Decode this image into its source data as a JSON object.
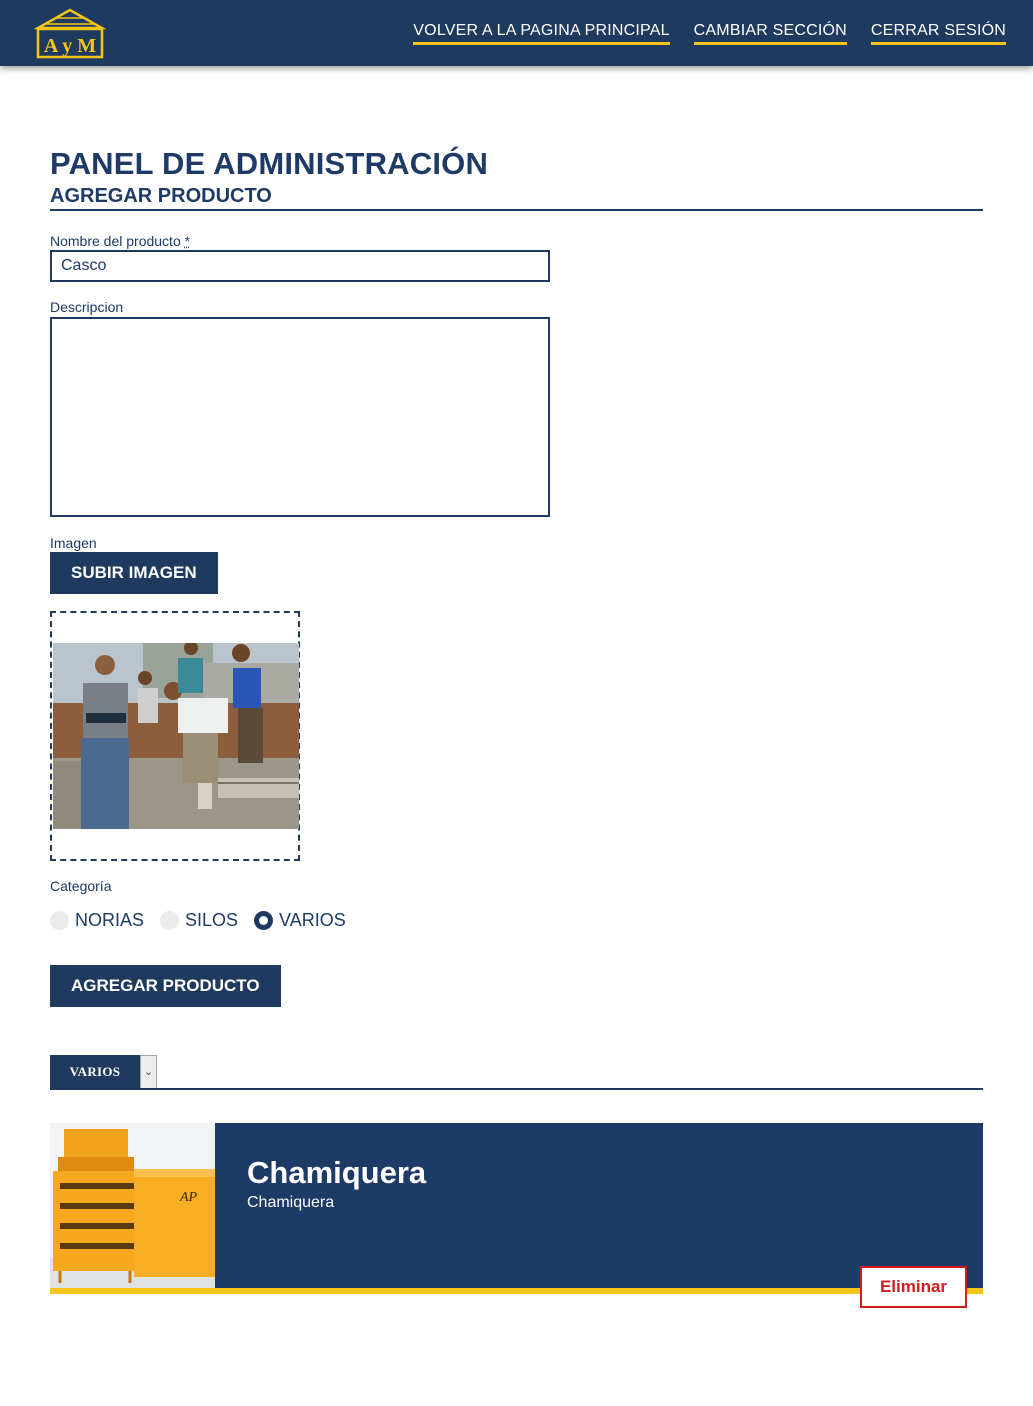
{
  "header": {
    "logo_text": "A y M",
    "nav": [
      {
        "label": "VOLVER A LA PAGINA PRINCIPAL"
      },
      {
        "label": "CAMBIAR SECCIÓN"
      },
      {
        "label": "CERRAR SESIÓN"
      }
    ]
  },
  "page": {
    "title": "PANEL DE ADMINISTRACIÓN",
    "section": "AGREGAR PRODUCTO"
  },
  "form": {
    "name_label": "Nombre del producto",
    "name_required_marker": "*",
    "name_value": "Casco",
    "description_label": "Descripcion",
    "description_value": "",
    "image_label": "Imagen",
    "upload_button": "SUBIR IMAGEN",
    "category_label": "Categoría",
    "categories": [
      {
        "label": "NORIAS",
        "checked": false
      },
      {
        "label": "SILOS",
        "checked": false
      },
      {
        "label": "VARIOS",
        "checked": true
      }
    ],
    "submit_button": "AGREGAR PRODUCTO"
  },
  "filter": {
    "selected": "VARIOS"
  },
  "products": [
    {
      "title": "Chamiquera",
      "description": "Chamiquera",
      "delete_label": "Eliminar"
    }
  ],
  "colors": {
    "navy": "#1e3a5f",
    "accent_yellow": "#f5c518",
    "danger": "#d11d1d"
  }
}
